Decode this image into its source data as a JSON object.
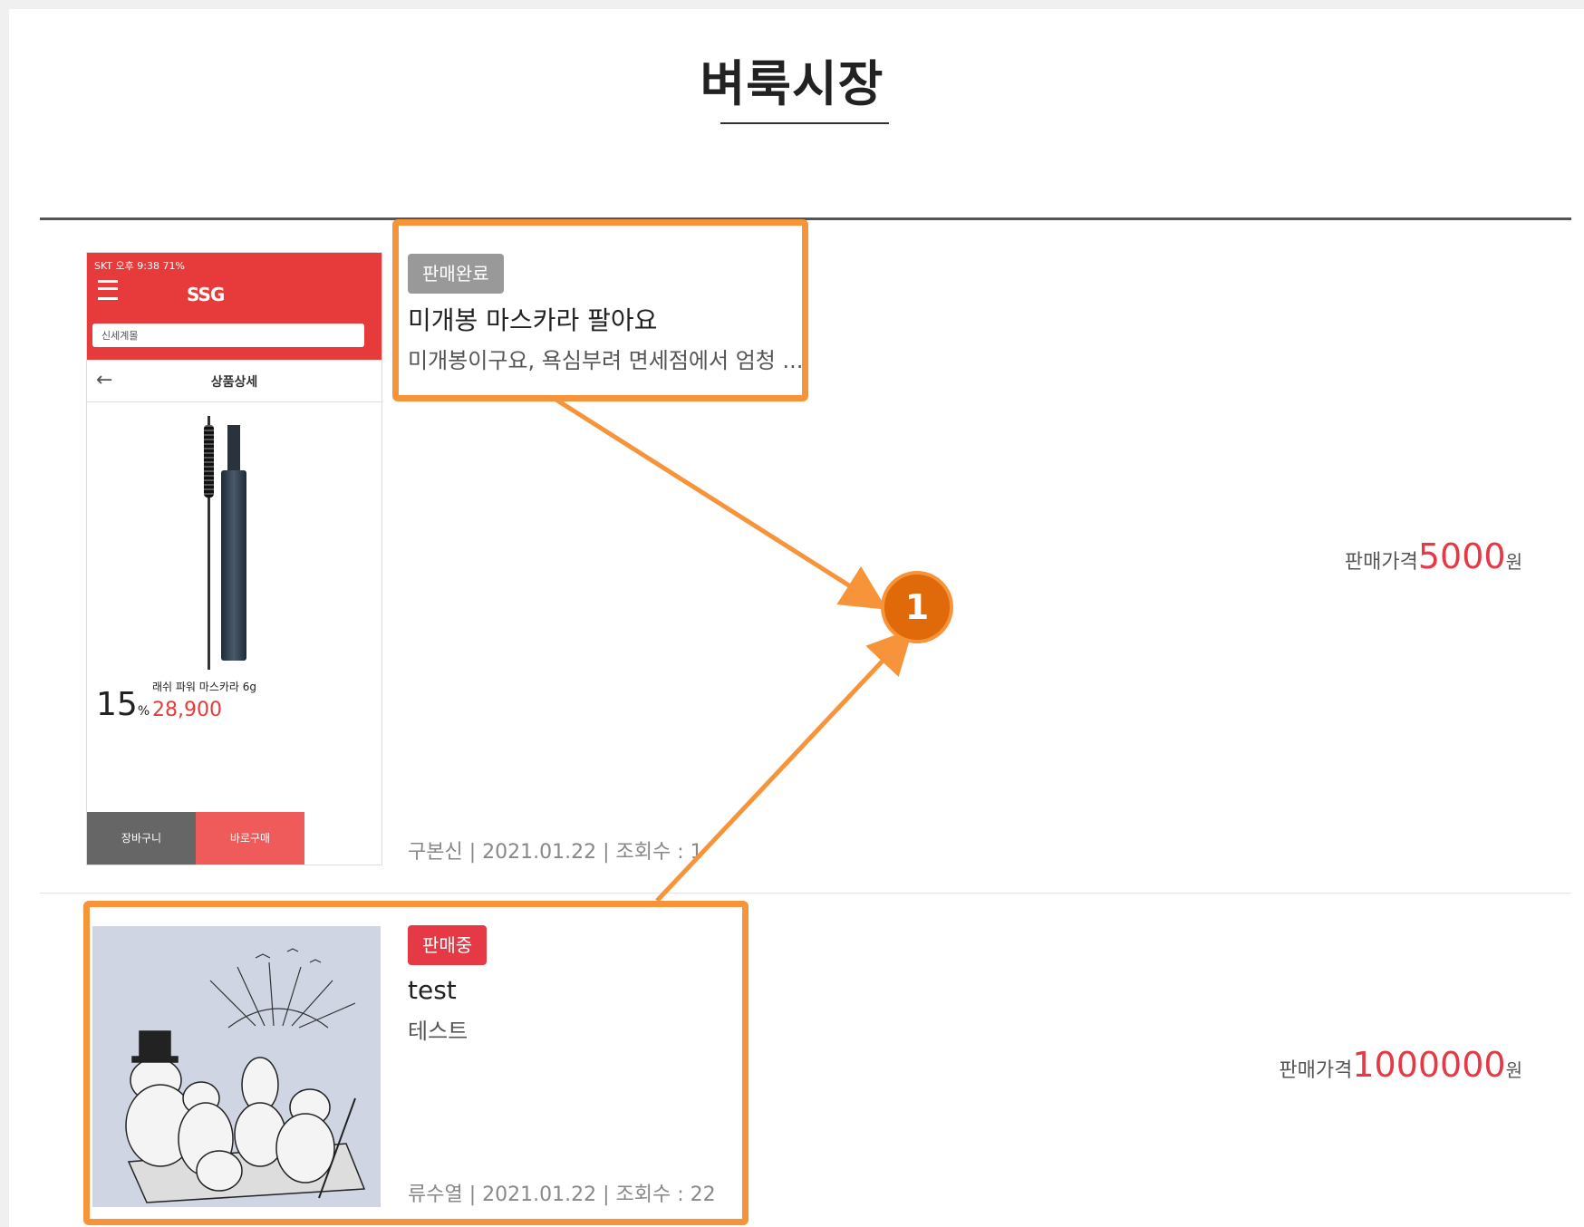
{
  "page": {
    "title": "벼룩시장"
  },
  "items": [
    {
      "status": "판매완료",
      "title": "미개봉 마스카라 팔아요",
      "description": "미개봉이구요, 욕심부려 면세점에서 엄청 ...",
      "author": "구본신",
      "date": "2021.01.22",
      "views_label": "조회수 : 1",
      "price_label": "판매가격",
      "price": "5000",
      "currency": "원",
      "thumbnail": {
        "status_bar": "SKT  오후 9:38  71%",
        "logo": "SSG",
        "search": "신세계몰",
        "header": "상품상세",
        "discount": "15",
        "discount_unit": "%",
        "product_name": "래쉬 파워 마스카라 6g",
        "product_price": "28,900",
        "cart_label": "장바구니",
        "buy_label": "바로구매"
      }
    },
    {
      "status": "판매중",
      "title": "test",
      "description": "테스트",
      "author": "류수열",
      "date": "2021.01.22",
      "views_label": "조회수 : 22",
      "price_label": "판매가격",
      "price": "1000000",
      "currency": "원"
    }
  ],
  "annotation": {
    "marker": "1",
    "color": "#f7943a"
  },
  "colors": {
    "sold_badge": "#999999",
    "on_sale_badge": "#e63946",
    "price": "#e63946"
  }
}
